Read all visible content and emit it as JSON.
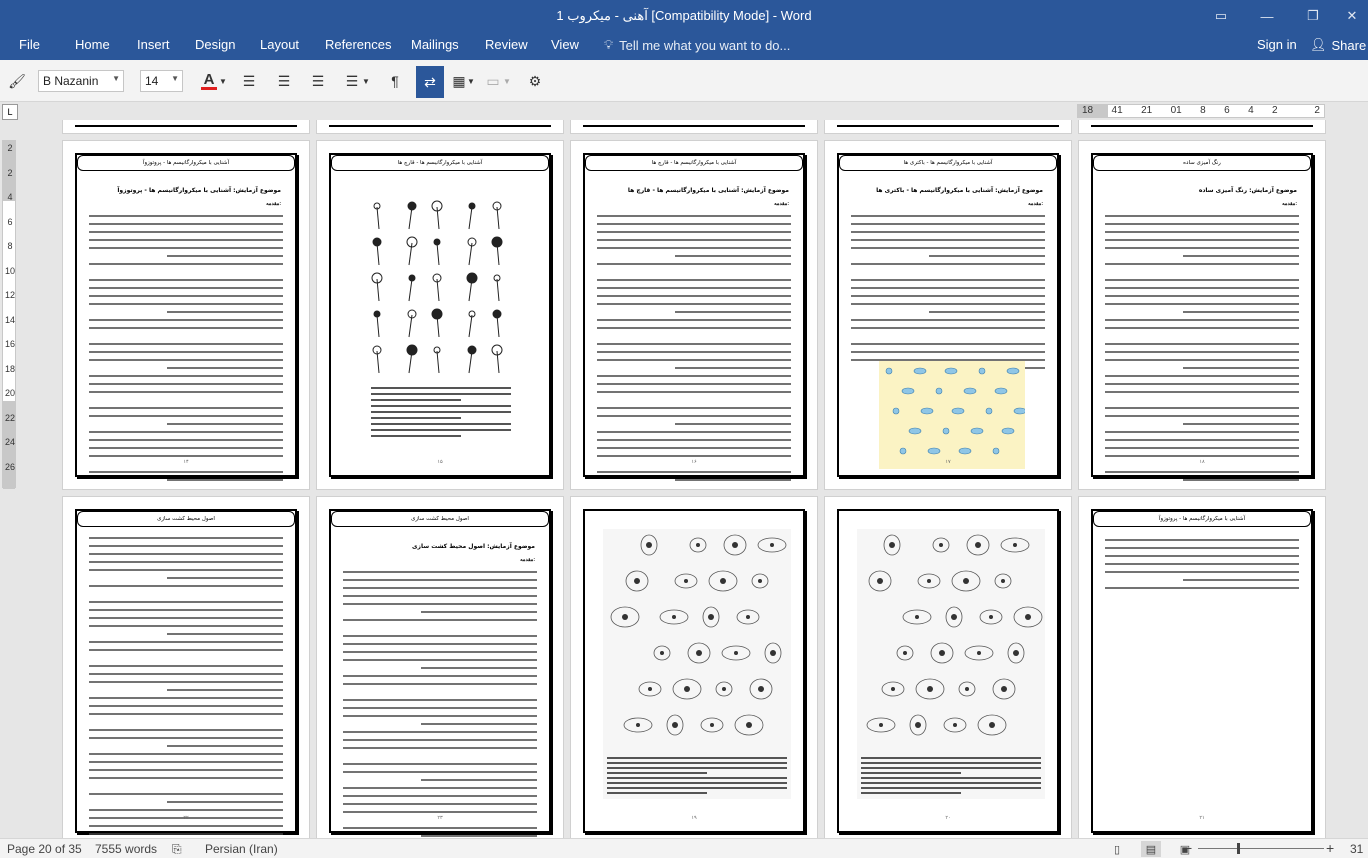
{
  "window": {
    "title": "آهنی - میکروب 1  [Compatibility Mode] - Word",
    "controls": [
      "restore-ribbon",
      "minimize",
      "maximize",
      "close"
    ]
  },
  "ribbon": {
    "file": "File",
    "tabs": [
      "Home",
      "Insert",
      "Design",
      "Layout",
      "References",
      "Mailings",
      "Review",
      "View"
    ],
    "tell_me": "Tell me what you want to do...",
    "sign_in": "Sign in",
    "share": "Share"
  },
  "toolbar": {
    "font_name": "B Nazanin",
    "font_size": "14",
    "font_color": "#e01f1f"
  },
  "ruler": {
    "corner": "L",
    "horizontal_numbers": [
      "18",
      "41",
      "21",
      "01",
      "8",
      "6",
      "4",
      "2",
      "",
      "2"
    ],
    "vertical_numbers": [
      "2",
      "2",
      "4",
      "6",
      "8",
      "10",
      "12",
      "14",
      "16",
      "18",
      "20",
      "22",
      "24",
      "26"
    ]
  },
  "pages": [
    {
      "header": "رنگ آمیزی ساده",
      "heading": "موضوع آزمایش: رنگ آمیزی ساده",
      "sub": "مقدمه:",
      "number": "۱۸",
      "kind": "text"
    },
    {
      "header": "آشنایی با میکروارگانیسم ها - باکتری ها",
      "heading": "موضوع آزمایش: آشنایی با میکروارگانیسم ها - باکتری ها",
      "sub": "مقدمه:",
      "number": "۱۷",
      "kind": "text-figure"
    },
    {
      "header": "آشنایی با میکروارگانیسم ها - قارچ ها",
      "heading": "موضوع آزمایش: آشنایی با میکروارگانیسم ها - قارچ ها",
      "sub": "مقدمه:",
      "number": "۱۶",
      "kind": "text"
    },
    {
      "header": "آشنایی با میکروارگانیسم ها - قارچ ها",
      "heading": "",
      "sub": "",
      "number": "۱۵",
      "kind": "figure"
    },
    {
      "header": "آشنایی با میکروارگانیسم ها - پروتوزوآ",
      "heading": "موضوع آزمایش: آشنایی با میکروارگانیسم ها - پروتوزوآ",
      "sub": "مقدمه:",
      "number": "۱۴",
      "kind": "text"
    },
    {
      "header": "آشنایی با میکروارگانیسم ها - پروتوزوآ",
      "heading": "",
      "sub": "",
      "number": "۲۱",
      "kind": "short-text"
    },
    {
      "header": "",
      "heading": "",
      "sub": "",
      "number": "۲۰",
      "kind": "figure-plate"
    },
    {
      "header": "",
      "heading": "",
      "sub": "",
      "number": "۱۹",
      "kind": "figure-plate"
    },
    {
      "header": "اصول محیط کشت سازی",
      "heading": "موضوع آزمایش: اصول محیط کشت سازی",
      "sub": "مقدمه:",
      "number": "۲۳",
      "kind": "text"
    },
    {
      "header": "اصول محیط کشت سازی",
      "heading": "",
      "sub": "",
      "number": "۲۲",
      "kind": "text-full"
    }
  ],
  "status": {
    "page": "Page 20 of 35",
    "words": "7555 words",
    "language": "Persian (Iran)",
    "zoom": "31 %"
  }
}
